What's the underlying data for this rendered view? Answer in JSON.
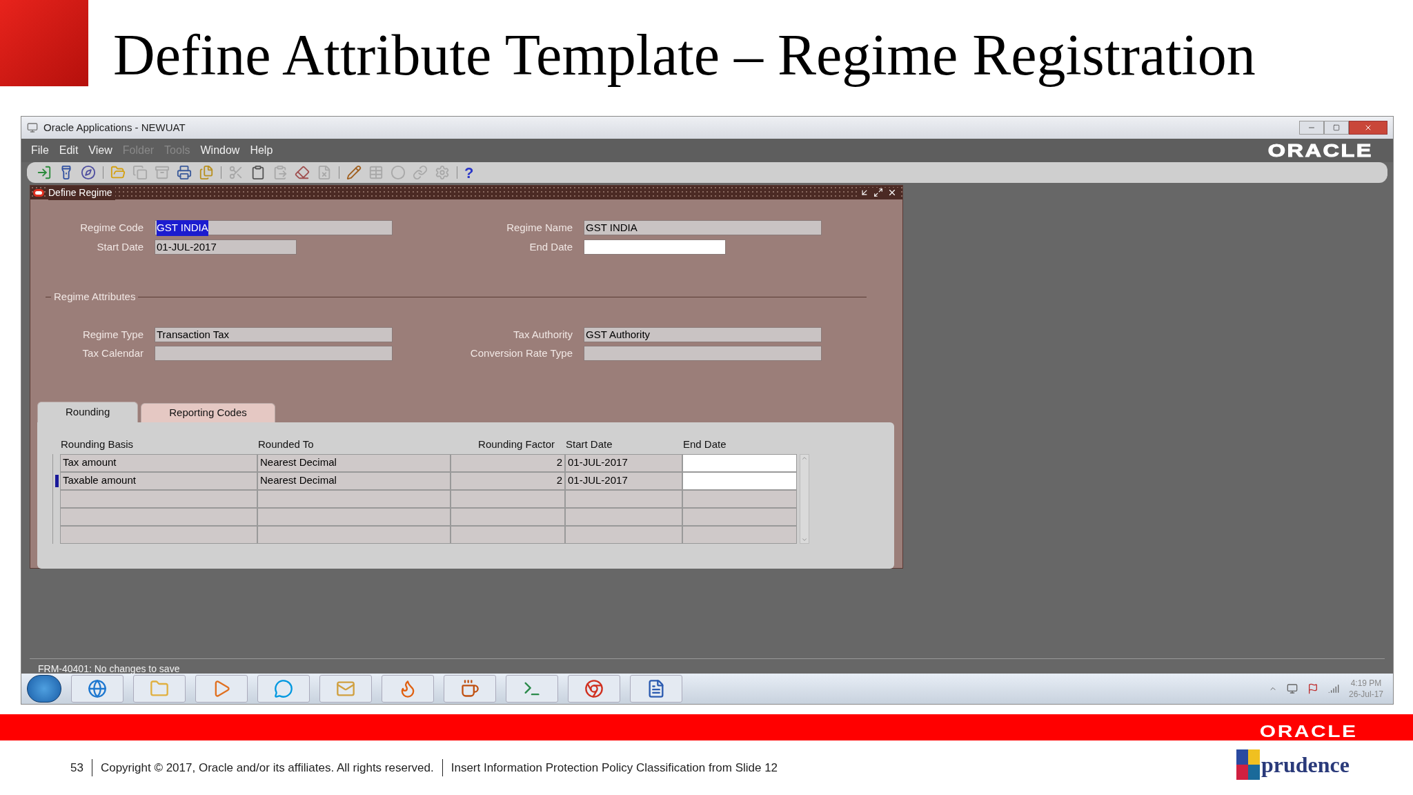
{
  "slide_title": "Define Attribute Template – Regime Registration",
  "window": {
    "title": "Oracle Applications - NEWUAT",
    "brand": "ORACLE"
  },
  "menu": [
    {
      "label": "File",
      "disabled": false
    },
    {
      "label": "Edit",
      "disabled": false
    },
    {
      "label": "View",
      "disabled": false
    },
    {
      "label": "Folder",
      "disabled": true
    },
    {
      "label": "Tools",
      "disabled": true
    },
    {
      "label": "Window",
      "disabled": false
    },
    {
      "label": "Help",
      "disabled": false
    }
  ],
  "toolbar": [
    [
      {
        "disabled": false
      },
      {
        "disabled": false
      },
      {
        "disabled": false
      }
    ],
    [
      {
        "disabled": false
      },
      {
        "disabled": true
      },
      {
        "disabled": true
      },
      {
        "disabled": false
      },
      {
        "disabled": false
      }
    ],
    [
      {
        "disabled": true
      },
      {
        "disabled": false
      },
      {
        "disabled": true
      },
      {
        "disabled": false
      },
      {
        "disabled": true
      }
    ],
    [
      {
        "disabled": false
      },
      {
        "disabled": true
      },
      {
        "disabled": true
      },
      {
        "disabled": true
      },
      {
        "disabled": true
      }
    ],
    [
      {
        "kind": "text",
        "label": "?",
        "disabled": false
      }
    ]
  ],
  "form": {
    "title": "Define Regime",
    "header_fields": [
      {
        "label": "Regime Code",
        "value": "GST INDIA",
        "kind": "text",
        "text_selected": true,
        "editable": false
      },
      {
        "label": "Regime Name",
        "value": "GST INDIA",
        "kind": "text",
        "text_selected": false,
        "editable": false
      },
      {
        "label": "Start Date",
        "value": "01-JUL-2017",
        "kind": "date",
        "text_selected": false,
        "editable": false
      },
      {
        "label": "End Date",
        "kind": "date",
        "editable": true
      }
    ],
    "section": "Regime Attributes",
    "attribute_fields": [
      {
        "label": "Regime Type",
        "value": "Transaction Tax",
        "kind": "text",
        "text_selected": false,
        "editable": false
      },
      {
        "label": "Tax Authority",
        "value": "GST Authority",
        "kind": "text",
        "text_selected": false,
        "editable": false
      },
      {
        "label": "Tax Calendar",
        "kind": "text",
        "editable": false
      },
      {
        "label": "Conversion Rate Type",
        "kind": "text",
        "editable": false
      }
    ],
    "tabs": [
      {
        "label": "Rounding",
        "selected": true
      },
      {
        "label": "Reporting Codes",
        "selected": false
      }
    ],
    "table": {
      "columns": [
        "Rounding Basis",
        "Rounded To",
        "Rounding Factor",
        "Start Date",
        "End Date"
      ],
      "rows": [
        {
          "cells": [
            "Tax amount",
            "Nearest Decimal",
            "2",
            "01-JUL-2017"
          ],
          "selected": false
        },
        {
          "cells": [
            "Taxable amount",
            "Nearest Decimal",
            "2",
            "01-JUL-2017"
          ],
          "selected": true
        }
      ]
    }
  },
  "status_bar": "FRM-40401: No changes to save",
  "clock": {
    "time": "4:19 PM",
    "date": "26-Jul-17"
  },
  "footer": {
    "brand": "ORACLE",
    "page": "53",
    "copyright": "Copyright © 2017, Oracle and/or its affiliates. All rights reserved.",
    "classification": "Insert Information Protection Policy Classification from Slide 12",
    "logo_text": "prudence"
  }
}
